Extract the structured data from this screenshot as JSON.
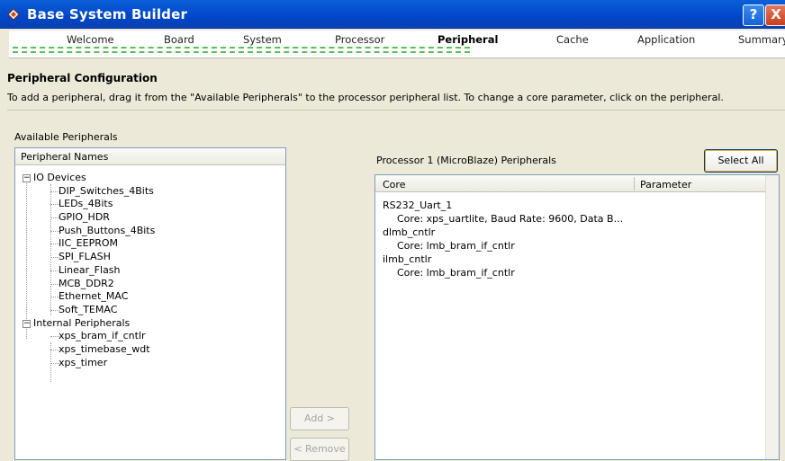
{
  "window": {
    "title": "Base System Builder",
    "help_label": "?",
    "close_label": "X"
  },
  "steps": [
    "Welcome",
    "Board",
    "System",
    "Processor",
    "Peripheral",
    "Cache",
    "Application",
    "Summary"
  ],
  "active_step": "Peripheral",
  "section": {
    "title": "Peripheral Configuration",
    "instructions": "To add a peripheral, drag it from the \"Available Peripherals\" to the processor peripheral list. To change a core parameter, click on the peripheral."
  },
  "available": {
    "label": "Available Peripherals",
    "column_header": "Peripheral Names",
    "groups": [
      {
        "name": "IO Devices",
        "expander": "−",
        "items": [
          "DIP_Switches_4Bits",
          "LEDs_4Bits",
          "GPIO_HDR",
          "Push_Buttons_4Bits",
          "IIC_EEPROM",
          "SPI_FLASH",
          "Linear_Flash",
          "MCB_DDR2",
          "Ethernet_MAC",
          "Soft_TEMAC"
        ]
      },
      {
        "name": "Internal Peripherals",
        "expander": "−",
        "items": [
          "xps_bram_if_cntlr",
          "xps_timebase_wdt",
          "xps_timer"
        ]
      }
    ]
  },
  "buttons": {
    "add": "Add >",
    "remove": "< Remove",
    "select_all": "Select All"
  },
  "processor": {
    "label": "Processor 1 (MicroBlaze) Peripherals",
    "columns": {
      "core": "Core",
      "parameter": "Parameter"
    },
    "cores": [
      {
        "name": "RS232_Uart_1",
        "detail": "Core: xps_uartlite, Baud Rate: 9600, Data B..."
      },
      {
        "name": "dlmb_cntlr",
        "detail": "Core: lmb_bram_if_cntlr"
      },
      {
        "name": "ilmb_cntlr",
        "detail": "Core: lmb_bram_if_cntlr"
      }
    ]
  },
  "colors": {
    "titlebar": "#0046c8",
    "progress": "#58c058",
    "face": "#ece9d8"
  }
}
